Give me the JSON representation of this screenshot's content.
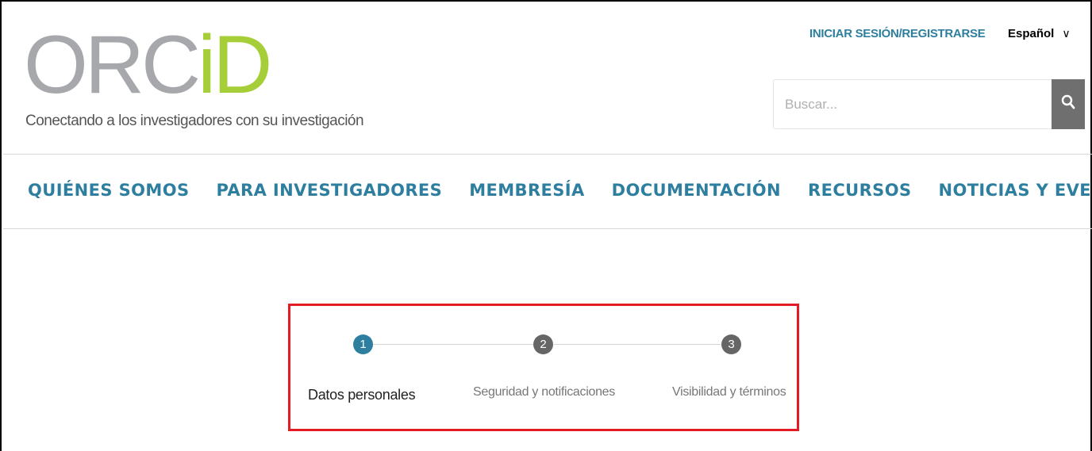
{
  "header": {
    "logo": {
      "orc": "ORC",
      "id": "iD"
    },
    "tagline": "Conectando a los investigadores con su investigación",
    "signin_label": "INICIAR SESIÓN/REGISTRARSE",
    "language": {
      "selected": "Español",
      "chevron": "∨"
    },
    "search": {
      "placeholder": "Buscar...",
      "icon": "search-icon"
    }
  },
  "nav": {
    "items": [
      {
        "label": "QUIÉNES SOMOS"
      },
      {
        "label": "PARA INVESTIGADORES"
      },
      {
        "label": "MEMBRESÍA"
      },
      {
        "label": "DOCUMENTACIÓN"
      },
      {
        "label": "RECURSOS"
      },
      {
        "label": "NOTICIAS Y EVENTOS"
      }
    ]
  },
  "stepper": {
    "steps": [
      {
        "number": "1",
        "label": "Datos personales",
        "state": "active"
      },
      {
        "number": "2",
        "label": "Seguridad y notificaciones",
        "state": "inactive"
      },
      {
        "number": "3",
        "label": "Visibilidad y términos",
        "state": "inactive"
      }
    ]
  },
  "colors": {
    "brand_teal": "#2e7f9f",
    "logo_grey": "#a6a8ab",
    "logo_green": "#a6ce39",
    "highlight_red": "#e31b23"
  }
}
